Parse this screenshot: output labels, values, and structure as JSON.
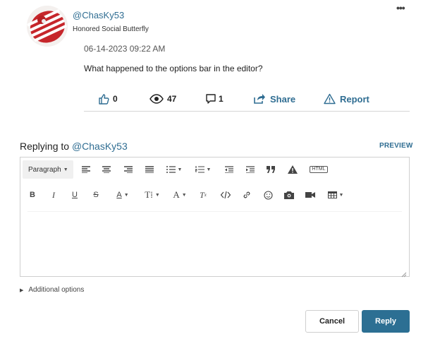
{
  "post": {
    "username": "@ChasKy53",
    "rank": "Honored Social Butterfly",
    "date": "06-14-2023 09:22 AM",
    "body": "What happened to the options bar in the editor?",
    "more_menu": "•••",
    "actions": {
      "likes": "0",
      "views": "47",
      "replies": "1",
      "share_label": "Share",
      "report_label": "Report"
    }
  },
  "reply": {
    "prefix": "Replying to ",
    "target": "@ChasKy53",
    "preview_label": "PREVIEW"
  },
  "editor": {
    "paragraph_label": "Paragraph",
    "html_label": "HTML",
    "toolbar_icons": [
      "align-left-icon",
      "align-center-icon",
      "align-right-icon",
      "justify-icon",
      "bullet-list-icon",
      "numbered-list-icon",
      "outdent-icon",
      "indent-icon",
      "blockquote-icon",
      "spoiler-icon",
      "html-icon",
      "bold-icon",
      "italic-icon",
      "underline-icon",
      "strikethrough-icon",
      "text-color-icon",
      "text-style-icon",
      "font-size-icon",
      "clear-format-icon",
      "code-icon",
      "link-icon",
      "emoji-icon",
      "photo-icon",
      "video-icon",
      "table-icon"
    ],
    "content": ""
  },
  "additional_options_label": "Additional options",
  "buttons": {
    "cancel_label": "Cancel",
    "reply_label": "Reply"
  },
  "colors": {
    "link": "#2f6d92",
    "primary_button": "#2c6f93",
    "border": "#cfcfcf"
  }
}
